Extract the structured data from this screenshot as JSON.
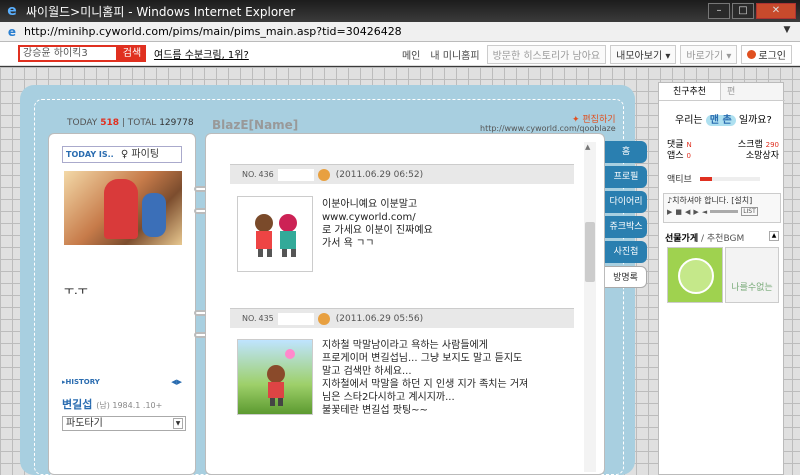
{
  "window": {
    "title": "싸이월드>미니홈피 - Windows Internet Explorer",
    "ie_icon": "e",
    "url": "http://minihp.cyworld.com/pims/main/pims_main.asp?tid=30426428"
  },
  "topnav": {
    "search_value": "강승윤 하이킥3",
    "search_button": "검색",
    "hot_link": "여드름 수분크림, 1위?",
    "menu": [
      "메인",
      "내 미니홈피"
    ],
    "history_btn": "방문한 히스토리가 남아요",
    "collect_btn": "내모아보기",
    "goto_btn": "바로가기",
    "login_btn": "로그인"
  },
  "left": {
    "today_label": "TODAY",
    "today_count": "518",
    "total_label": "TOTAL",
    "total_count": "129778",
    "today_is_label": "TODAY IS..",
    "today_mood": "파이팅",
    "status_text": "ㅜ.ㅜ",
    "history_label": "▸HISTORY",
    "history_arrows": "◀▶",
    "profile_name": "변길섭",
    "profile_info": "(남) 1984.1 .10+",
    "select_value": "파도타기"
  },
  "center": {
    "mini_title": "BlazE[Name]",
    "edit_link": "✦ 편집하기",
    "cy_url": "http://www.cyworld.com/qooblaze",
    "posts": [
      {
        "no_label": "NO.",
        "no": "436",
        "date": "(2011.06.29 06:52)",
        "lines": [
          "이분아니예요 이분말고",
          "www.cyworld.com/",
          "로 가세요 이분이 진짜예요",
          "가서 욕 ㄱㄱ"
        ]
      },
      {
        "no_label": "NO.",
        "no": "435",
        "date": "(2011.06.29 05:56)",
        "lines": [
          "지하철 막말남이라고 욕하는 사람들에게",
          "프로게이머 변길섭님... 그냥 보지도 말고 듣지도",
          "말고 검색만 하세요...",
          "지하철에서 막말을 하던 지 인생 지가 족치는 거져",
          "님은 스타2다시하고 계시지까...",
          "불꽃테란 변길섭 팟팅~~"
        ]
      }
    ]
  },
  "tabs": [
    "홈",
    "프로필",
    "다이어리",
    "쥬크박스",
    "사진첩",
    "방명록"
  ],
  "side": {
    "tab1": "친구추천",
    "tab2": "편",
    "question_pre": "우리는",
    "question_pill": "맨 촌",
    "question_post": "일까요?",
    "stats": [
      {
        "label": "댓글",
        "value": "N",
        "label2": "스크랩",
        "value2": "290"
      },
      {
        "label": "앱스",
        "value": "0",
        "label2": "소망상자",
        "value2": ""
      }
    ],
    "activity_label": "액티브",
    "activity_fraction": 0.2,
    "player_song": "♪치하셔야 합니다. [설치]",
    "player_list": "LIST",
    "gift_title": "선물가게",
    "gift_sub": "/ 추천BGM",
    "gift2_text": "나를수없는"
  },
  "colors": {
    "accent": "#e03020",
    "tab_blue": "#2a7fb0",
    "frame": "#a8cfe0"
  }
}
